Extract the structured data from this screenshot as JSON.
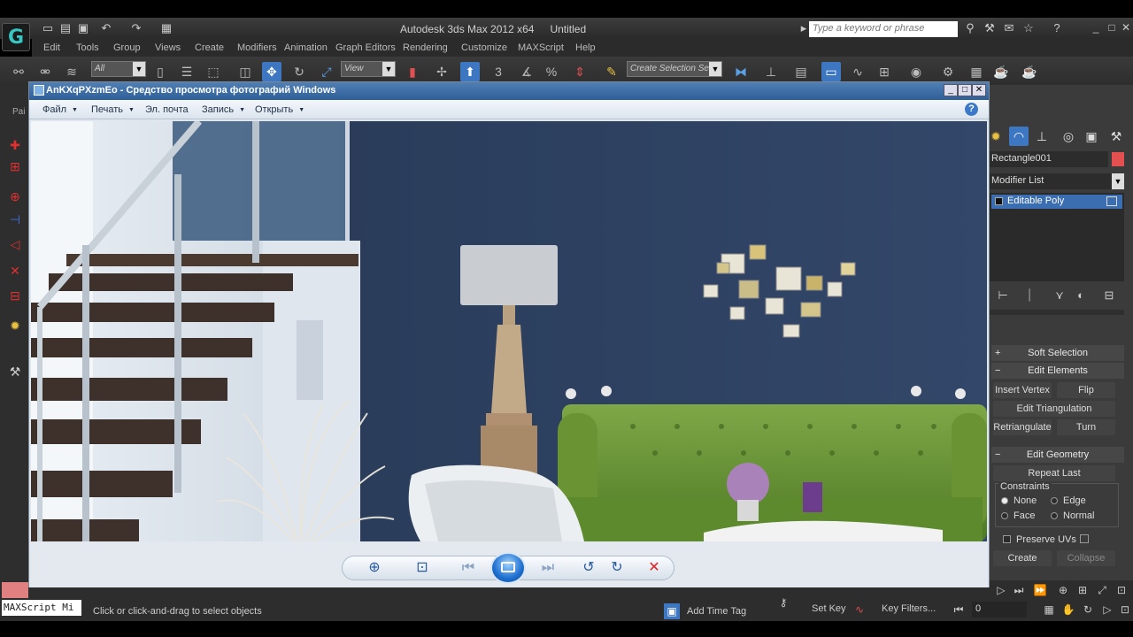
{
  "max": {
    "title": "Autodesk 3ds Max  2012 x64",
    "doc": "Untitled",
    "search_placeholder": "Type a keyword or phrase",
    "logo_glyph": "G",
    "menu": [
      "Edit",
      "Tools",
      "Group",
      "Views",
      "Create",
      "Modifiers",
      "Animation",
      "Graph Editors",
      "Rendering",
      "Customize",
      "MAXScript",
      "Help"
    ],
    "toolbar": {
      "filter_value": "All",
      "refcoord_value": "View",
      "selset_value": "Create Selection Se",
      "snap_label": "3",
      "percent_label": "%"
    },
    "left_strip_label": "Pai",
    "window_buttons": [
      "_",
      "□",
      "✕"
    ]
  },
  "command_panel": {
    "object_name": "Rectangle001",
    "object_color": "#e45050",
    "modifier_list": "Modifier List",
    "stack_item": "Editable Poly",
    "rollouts": {
      "soft_selection": "Soft Selection",
      "edit_elements": "Edit Elements",
      "edit_geometry": "Edit Geometry"
    },
    "buttons": {
      "insert_vertex": "Insert Vertex",
      "flip": "Flip",
      "edit_triangulation": "Edit Triangulation",
      "retriangulate": "Retriangulate",
      "turn": "Turn",
      "repeat_last": "Repeat Last",
      "create": "Create",
      "collapse": "Collapse"
    },
    "constraints": {
      "label": "Constraints",
      "none": "None",
      "edge": "Edge",
      "face": "Face",
      "normal": "Normal",
      "selected": "None"
    },
    "preserve_uvs": "Preserve UVs"
  },
  "status": {
    "maxscript": "MAXScript Mi",
    "prompt": "Click or click-and-drag to select objects",
    "add_time_tag": "Add Time Tag",
    "set_key": "Set Key",
    "key_filters": "Key Filters...",
    "frame": "0"
  },
  "viewer": {
    "title": "AnKXqPXzmEo - Средство просмотра фотографий Windows",
    "menu": [
      "Файл",
      "Печать",
      "Эл. почта",
      "Запись",
      "Открыть"
    ],
    "help": "?"
  },
  "colors": {
    "wall": "#2b3d5c",
    "sofa": "#6f9a3a",
    "accent": "#3b6eb0"
  }
}
